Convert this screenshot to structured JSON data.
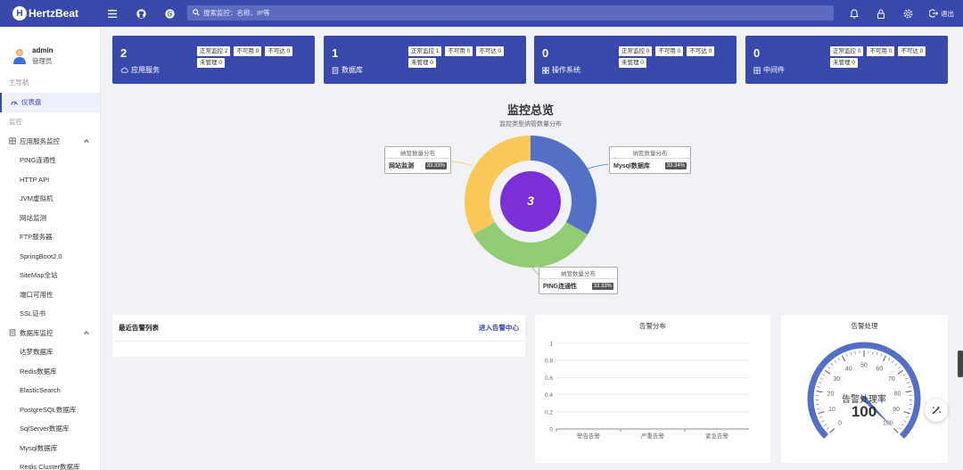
{
  "header": {
    "logo_text": "HertzBeat",
    "search_placeholder": "搜索监控：名称、IP等",
    "logout_label": "退出"
  },
  "user": {
    "name": "admin",
    "role": "管理员"
  },
  "sidebar": {
    "group_main": "主导航",
    "dashboard": "仪表盘",
    "group_monitor": "监控",
    "app_service_group": "应用服务监控",
    "app_service_items": [
      "PING连通性",
      "HTTP API",
      "JVM虚拟机",
      "网站监测",
      "FTP服务器",
      "SpringBoot2.0",
      "SiteMap全站",
      "端口可用性",
      "SSL证书"
    ],
    "db_group": "数据库监控",
    "db_items": [
      "达梦数据库",
      "Redis数据库",
      "ElasticSearch",
      "PostgreSQL数据库",
      "SqlServer数据库",
      "Mysql数据库",
      "Redis Cluster数据库"
    ]
  },
  "cards": [
    {
      "count": "2",
      "label": "应用服务",
      "icon": "cloud-icon",
      "tags": [
        "正常监控 2",
        "不可用 0",
        "不可达 0",
        "未管理 0"
      ]
    },
    {
      "count": "1",
      "label": "数据库",
      "icon": "database-icon",
      "tags": [
        "正常监控 1",
        "不可用 0",
        "不可达 0",
        "未管理 0"
      ]
    },
    {
      "count": "0",
      "label": "操作系统",
      "icon": "os-icon",
      "tags": [
        "正常监控 0",
        "不可用 0",
        "不可达 0",
        "未管理 0"
      ]
    },
    {
      "count": "0",
      "label": "中间件",
      "icon": "middleware-icon",
      "tags": [
        "正常监控 0",
        "不可用 0",
        "不可达 0",
        "未管理 0"
      ]
    }
  ],
  "overview": {
    "title": "监控总览",
    "subtitle": "监控类型纳管数量分布",
    "total": "3",
    "tooltip_header": "纳管数量分布",
    "segments": [
      {
        "name": "Mysql数据库",
        "percent": "33.34%",
        "value": 1,
        "color": "#5470c6"
      },
      {
        "name": "PING连通性",
        "percent": "33.33%",
        "value": 1,
        "color": "#91cc75"
      },
      {
        "name": "网站监测",
        "percent": "33.33%",
        "value": 1,
        "color": "#fac858"
      }
    ],
    "center_color": "#7b2fd6"
  },
  "alerts_panel": {
    "title": "最近告警列表",
    "link": "进入告警中心"
  },
  "chart_data": [
    {
      "type": "bar",
      "title": "告警分布",
      "categories": [
        "警告告警",
        "严重告警",
        "紧急告警"
      ],
      "values": [
        0,
        0,
        0
      ],
      "ylim": [
        0,
        1
      ],
      "yticks": [
        "0",
        "0.2",
        "0.4",
        "0.6",
        "0.8",
        "1"
      ],
      "grid": true
    }
  ],
  "gauge": {
    "title": "告警处理",
    "label": "告警处理率",
    "value": 100,
    "value_text": "100",
    "min": 0,
    "max": 100,
    "ticks": [
      "0",
      "10",
      "20",
      "30",
      "40",
      "50",
      "60",
      "70",
      "80",
      "90",
      "100"
    ],
    "color": "#5470c6"
  }
}
